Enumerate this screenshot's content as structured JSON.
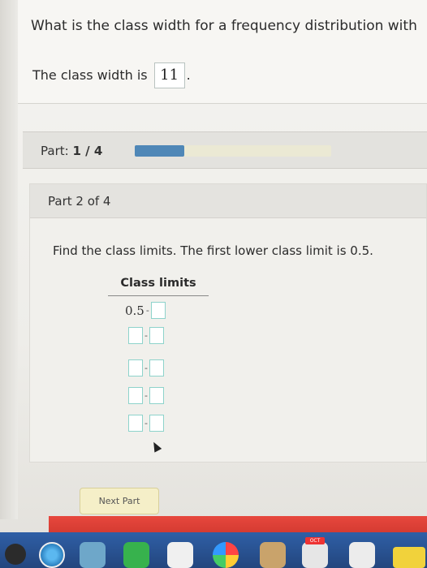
{
  "question": {
    "text": "What is the class width for a frequency distribution with",
    "answer_prefix": "The class width is",
    "answer_value": "11",
    "answer_suffix": "."
  },
  "progress": {
    "label": "Part:",
    "current": "1",
    "separator": "/",
    "total": "4",
    "fraction": 0.25
  },
  "part": {
    "title": "Part 2 of 4",
    "instruction": "Find the class limits. The first lower class limit is 0.5.",
    "table_header": "Class limits",
    "first_lower": "0.5",
    "dash": "-"
  },
  "buttons": {
    "next_part": "Next Part"
  },
  "dock": {
    "calendar_tag": "OCT"
  },
  "colors": {
    "progress_fill": "#4f87b7",
    "input_border": "#8ed3cb",
    "next_button_bg": "#f5efc8",
    "red_strip": "#e7473d",
    "dock_bg": "#2f5fa6"
  }
}
